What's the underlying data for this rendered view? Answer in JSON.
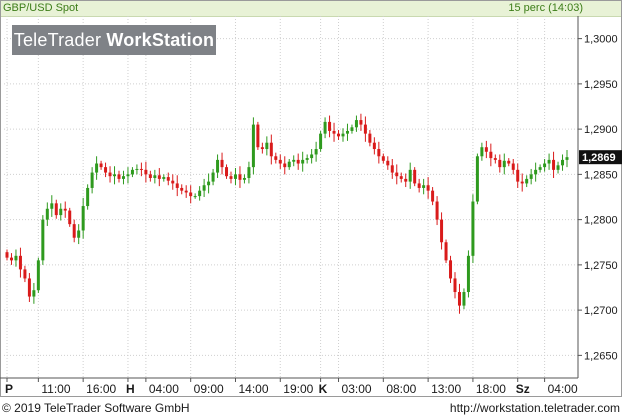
{
  "header": {
    "instrument": "GBP/USD Spot",
    "update": "15 perc (14:03)"
  },
  "logo": {
    "part1": "TeleTrader ",
    "part2": "WorkStation"
  },
  "footer": {
    "copyright": "© 2019 TeleTrader Software GmbH",
    "url": "http://workstation.teletrader.com"
  },
  "colors": {
    "up": "#2e9a1e",
    "down": "#d91b1b",
    "grid": "#cfcfcf",
    "header_bg": "#e8f2d6",
    "last_bg": "#111111"
  },
  "chart_data": {
    "type": "line",
    "style": "candlestick",
    "ylim": [
      1.2625,
      1.3025
    ],
    "grid": "dotted",
    "y_ticks": [
      "1,2650",
      "1,2700",
      "1,2750",
      "1,2800",
      "1,2850",
      "1,2900",
      "1,2950",
      "1,3000"
    ],
    "y_tick_values": [
      1.265,
      1.27,
      1.275,
      1.28,
      1.285,
      1.29,
      1.295,
      1.3
    ],
    "last_value": 1.2869,
    "last_label": "1,2869",
    "x_ticks": [
      {
        "label": "P",
        "bold": true,
        "index": 0
      },
      {
        "label": "11:00",
        "bold": false,
        "index": 7
      },
      {
        "label": "16:00",
        "bold": false,
        "index": 17
      },
      {
        "label": "H",
        "bold": true,
        "index": 27
      },
      {
        "label": "04:00",
        "bold": false,
        "index": 31
      },
      {
        "label": "09:00",
        "bold": false,
        "index": 41
      },
      {
        "label": "14:00",
        "bold": false,
        "index": 51
      },
      {
        "label": "19:00",
        "bold": false,
        "index": 61
      },
      {
        "label": "K",
        "bold": true,
        "index": 70
      },
      {
        "label": "03:00",
        "bold": false,
        "index": 74
      },
      {
        "label": "08:00",
        "bold": false,
        "index": 84
      },
      {
        "label": "13:00",
        "bold": false,
        "index": 94
      },
      {
        "label": "18:00",
        "bold": false,
        "index": 104
      },
      {
        "label": "Sz",
        "bold": true,
        "index": 114
      },
      {
        "label": "04:00",
        "bold": false,
        "index": 120
      }
    ],
    "close": [
      1.2758,
      1.2755,
      1.276,
      1.2745,
      1.2735,
      1.2715,
      1.2722,
      1.2755,
      1.28,
      1.2812,
      1.2818,
      1.2805,
      1.2812,
      1.281,
      1.2795,
      1.278,
      1.2788,
      1.2815,
      1.2835,
      1.2852,
      1.2862,
      1.2858,
      1.2852,
      1.2848,
      1.285,
      1.2845,
      1.2848,
      1.285,
      1.2855,
      1.2856,
      1.2855,
      1.285,
      1.2846,
      1.2849,
      1.2845,
      1.2847,
      1.2843,
      1.284,
      1.2835,
      1.2832,
      1.283,
      1.2826,
      1.2826,
      1.2832,
      1.2838,
      1.2842,
      1.2852,
      1.2866,
      1.2858,
      1.2848,
      1.2845,
      1.285,
      1.2844,
      1.2846,
      1.2858,
      1.2905,
      1.288,
      1.2878,
      1.2885,
      1.287,
      1.2866,
      1.2862,
      1.2858,
      1.2864,
      1.2866,
      1.2862,
      1.2866,
      1.2868,
      1.2872,
      1.2878,
      1.2895,
      1.2908,
      1.2898,
      1.2895,
      1.2892,
      1.2895,
      1.2898,
      1.2902,
      1.291,
      1.2905,
      1.2895,
      1.2885,
      1.2878,
      1.287,
      1.2865,
      1.286,
      1.2852,
      1.2848,
      1.2845,
      1.2842,
      1.2855,
      1.284,
      1.2835,
      1.2838,
      1.2832,
      1.282,
      1.28,
      1.2775,
      1.2755,
      1.2735,
      1.272,
      1.2705,
      1.272,
      1.276,
      1.282,
      1.287,
      1.288,
      1.2875,
      1.2868,
      1.2866,
      1.2858,
      1.2865,
      1.2862,
      1.2855,
      1.2842,
      1.284,
      1.2845,
      1.285,
      1.2855,
      1.2858,
      1.2862,
      1.2866,
      1.2855,
      1.286,
      1.2866,
      1.2869
    ]
  }
}
